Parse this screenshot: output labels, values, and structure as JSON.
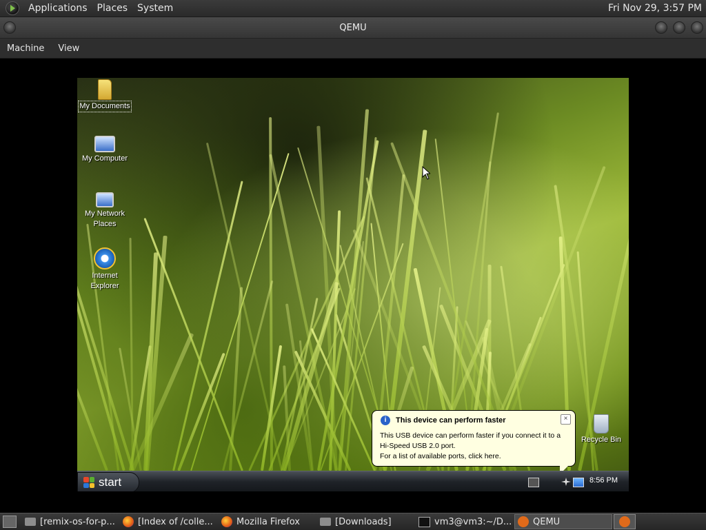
{
  "top_panel": {
    "menus": [
      "Applications",
      "Places",
      "System"
    ],
    "clock": "Fri Nov 29,  3:57 PM"
  },
  "window": {
    "title": "QEMU",
    "menus": [
      "Machine",
      "View"
    ]
  },
  "guest": {
    "desktop_icons": [
      {
        "label": "My Documents",
        "icon": "folder-icon"
      },
      {
        "label": "My Computer",
        "icon": "computer-icon"
      },
      {
        "label": "My Network Places",
        "icon": "network-icon"
      },
      {
        "label": "Internet Explorer",
        "icon": "ie-icon"
      }
    ],
    "recycle_bin_label": "Recycle Bin",
    "balloon": {
      "title": "This device can perform faster",
      "line1": "This USB device can perform faster if you connect it to a",
      "line2": "Hi-Speed USB 2.0 port.",
      "line3": "For a list of available ports, click here."
    },
    "start_label": "start",
    "clock": "8:56 PM"
  },
  "bottom_panel": {
    "tasks": [
      {
        "label": "[remix-os-for-p...",
        "icon": "folder-icon"
      },
      {
        "label": "[Index of /colle...",
        "icon": "firefox-icon"
      },
      {
        "label": "Mozilla Firefox",
        "icon": "firefox-icon"
      },
      {
        "label": "[Downloads]",
        "icon": "folder-icon"
      },
      {
        "label": "vm3@vm3:~/D...",
        "icon": "terminal-icon"
      },
      {
        "label": "QEMU",
        "icon": "qemu-icon",
        "active": true
      }
    ]
  }
}
